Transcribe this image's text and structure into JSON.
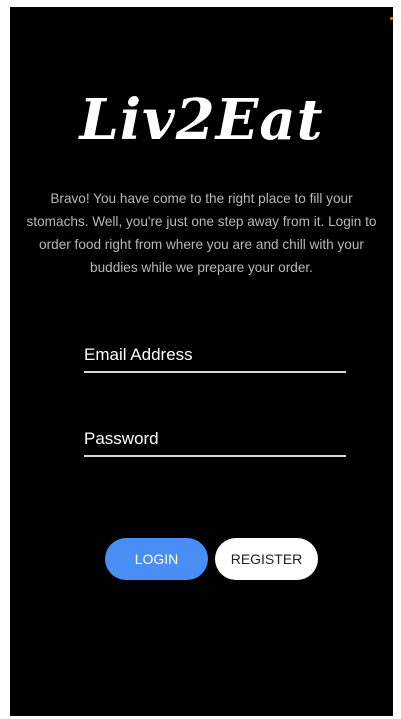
{
  "app": {
    "logo_text": "Liv2Eat"
  },
  "intro": {
    "text": "Bravo! You have come to the right place to fill your stomachs. Well, you're just one step away from it. Login to order food right from where you are and chill with your buddies while we prepare your order."
  },
  "form": {
    "email_placeholder": "Email Address",
    "email_value": "",
    "password_placeholder": "Password",
    "password_value": ""
  },
  "actions": {
    "login_label": "LOGIN",
    "register_label": "REGISTER"
  },
  "colors": {
    "background": "#000000",
    "login_button": "#4a8ef5",
    "register_button": "#ffffff",
    "accent_dot": "#e07b1f"
  }
}
